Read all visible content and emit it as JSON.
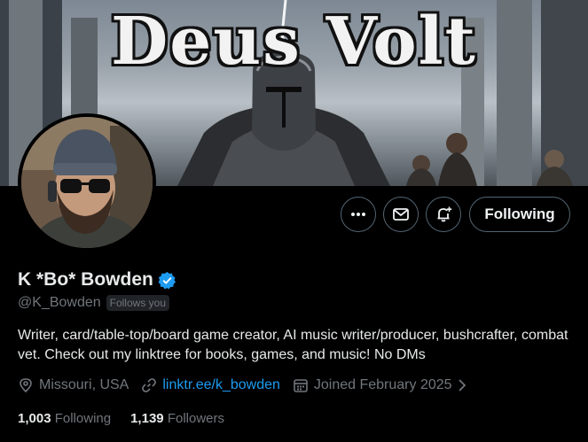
{
  "banner": {
    "title": "Deus Volt"
  },
  "actions": {
    "more_icon": "more-icon",
    "message_icon": "message-icon",
    "notify_icon": "notification-add-icon",
    "following_label": "Following"
  },
  "profile": {
    "display_name": "K *Bo* Bowden",
    "handle": "@K_Bowden",
    "follows_you": "Follows you",
    "bio": "Writer, card/table-top/board game creator, AI music writer/producer, bushcrafter, combat vet. Check out my linktree for books, games, and music! No DMs",
    "location": "Missouri, USA",
    "link": "linktr.ee/k_bowden",
    "joined": "Joined February 2025",
    "following_count": "1,003",
    "following_label": "Following",
    "followers_count": "1,139",
    "followers_label": "Followers"
  },
  "colors": {
    "accent": "#1d9bf0",
    "muted": "#71767b",
    "text": "#e7e9ea",
    "border": "#536471"
  }
}
